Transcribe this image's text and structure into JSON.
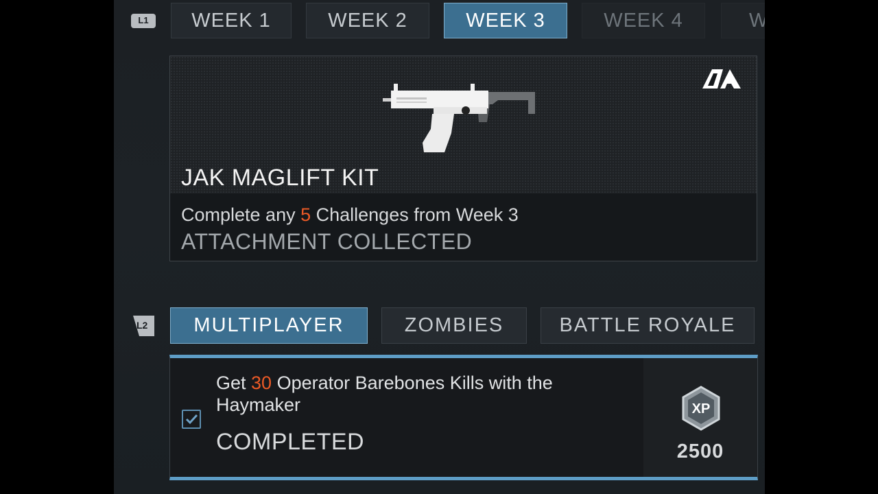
{
  "bumpers": {
    "top": "L1",
    "mode": "L2"
  },
  "week_tabs": [
    {
      "label": "WEEK 1",
      "state": "normal"
    },
    {
      "label": "WEEK 2",
      "state": "normal"
    },
    {
      "label": "WEEK 3",
      "state": "active"
    },
    {
      "label": "WEEK 4",
      "state": "locked"
    },
    {
      "label": "W",
      "state": "locked"
    }
  ],
  "reward": {
    "title": "JAK MAGLIFT KIT",
    "desc_prefix": "Complete any ",
    "desc_count": "5",
    "desc_suffix": " Challenges from Week 3",
    "status": "ATTACHMENT COLLECTED",
    "badge_icon": "attachment-icon",
    "image_icon": "smg-weapon-icon"
  },
  "mode_tabs": [
    {
      "label": "MULTIPLAYER",
      "state": "active"
    },
    {
      "label": "ZOMBIES",
      "state": "normal"
    },
    {
      "label": "BATTLE ROYALE",
      "state": "normal"
    }
  ],
  "challenge": {
    "text_prefix": "Get ",
    "count": "30",
    "text_suffix": " Operator Barebones Kills with the Haymaker",
    "status": "COMPLETED",
    "checked": true,
    "xp_icon": "xp-badge-icon",
    "xp_amount": "2500"
  },
  "colors": {
    "accent_blue": "#3c6f90",
    "highlight_orange": "#ec5a26",
    "border_blue": "#5e9dc6"
  }
}
